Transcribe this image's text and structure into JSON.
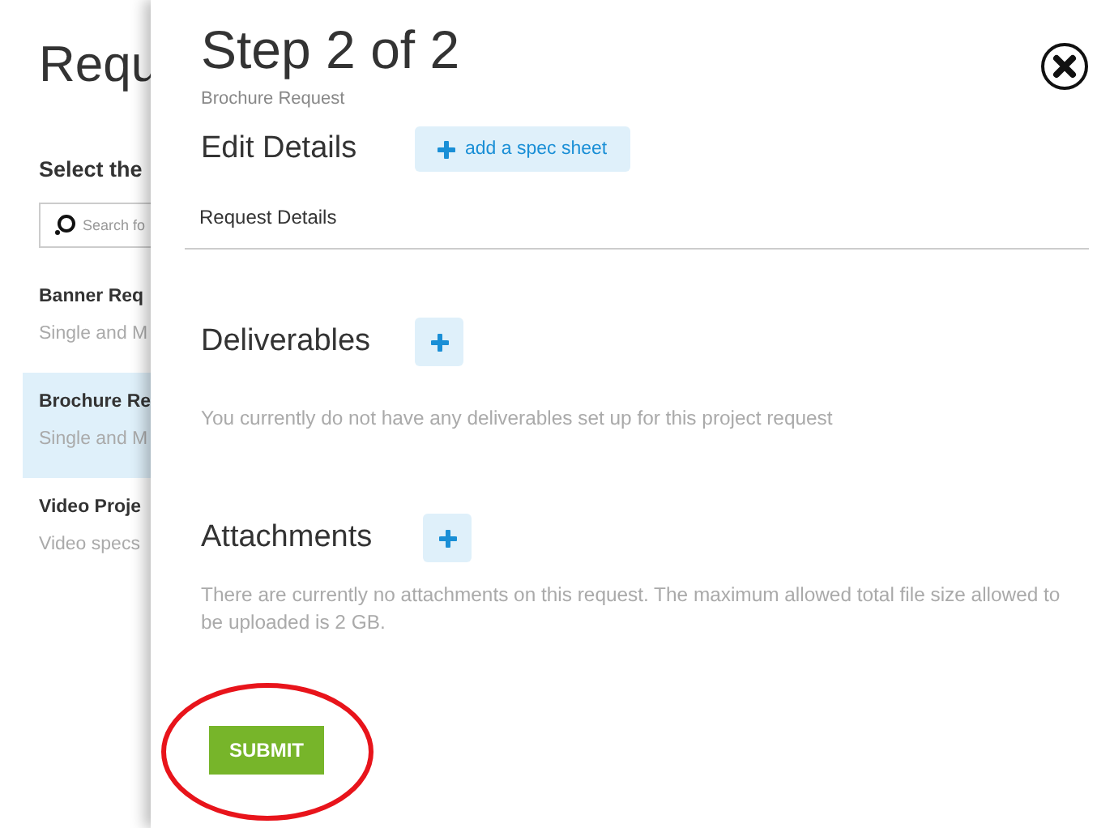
{
  "background": {
    "title": "Requ",
    "prompt": "Select the",
    "search": {
      "placeholder": "Search fo"
    },
    "items": [
      {
        "name": "Banner Req",
        "description": "Single and M",
        "selected": false
      },
      {
        "name": "Brochure Re",
        "description": "Single and M",
        "selected": true
      },
      {
        "name": "Video Proje",
        "description": "Video specs",
        "selected": false
      }
    ]
  },
  "panel": {
    "title": "Step 2 of 2",
    "subtitle": "Brochure Request",
    "edit_details": {
      "heading": "Edit Details",
      "button": "add a spec sheet"
    },
    "tab": "Request Details",
    "sections": [
      {
        "heading": "Deliverables",
        "text": "You currently do not have any deliverables set up for this project request"
      },
      {
        "heading": "Attachments",
        "text": "There are currently no attachments on this request. The maximum allowed total file size allowed to be uploaded is 2 GB."
      }
    ],
    "submit_button": "SUBMIT"
  }
}
